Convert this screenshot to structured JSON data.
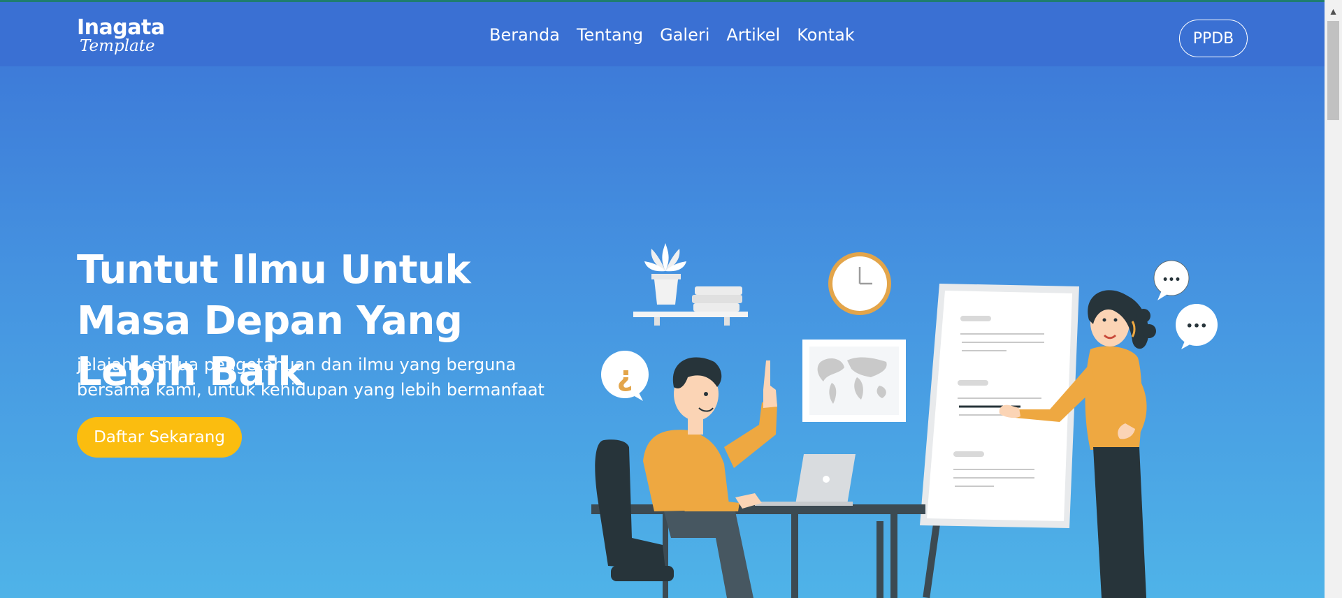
{
  "brand": {
    "line1": "Inagata",
    "line2": "Template"
  },
  "nav": {
    "items": [
      {
        "label": "Beranda"
      },
      {
        "label": "Tentang"
      },
      {
        "label": "Galeri"
      },
      {
        "label": "Artikel"
      },
      {
        "label": "Kontak"
      }
    ],
    "ppdb_label": "PPDB"
  },
  "hero": {
    "title": "Tuntut Ilmu Untuk Masa Depan Yang Lebih Baik",
    "subtitle": "jelajahi semua pengetahuan dan ilmu yang berguna bersama kami, untuk kehidupan yang lebih bermanfaat",
    "cta_label": "Daftar Sekarang"
  },
  "illustration": {
    "question_glyph": "¿",
    "speech_glyph": "•••"
  },
  "colors": {
    "header": "#3a70d3",
    "gradient_top": "#3b74d6",
    "gradient_bottom": "#4fb3e8",
    "cta": "#fbbd0f",
    "shirt": "#eea841",
    "dark": "#27343a"
  },
  "icons": [
    "chevron-up-icon",
    "question-bubble-icon",
    "speech-bubble-icon",
    "clock-icon",
    "world-map-icon",
    "plant-icon",
    "books-icon",
    "laptop-icon",
    "whiteboard-icon"
  ]
}
